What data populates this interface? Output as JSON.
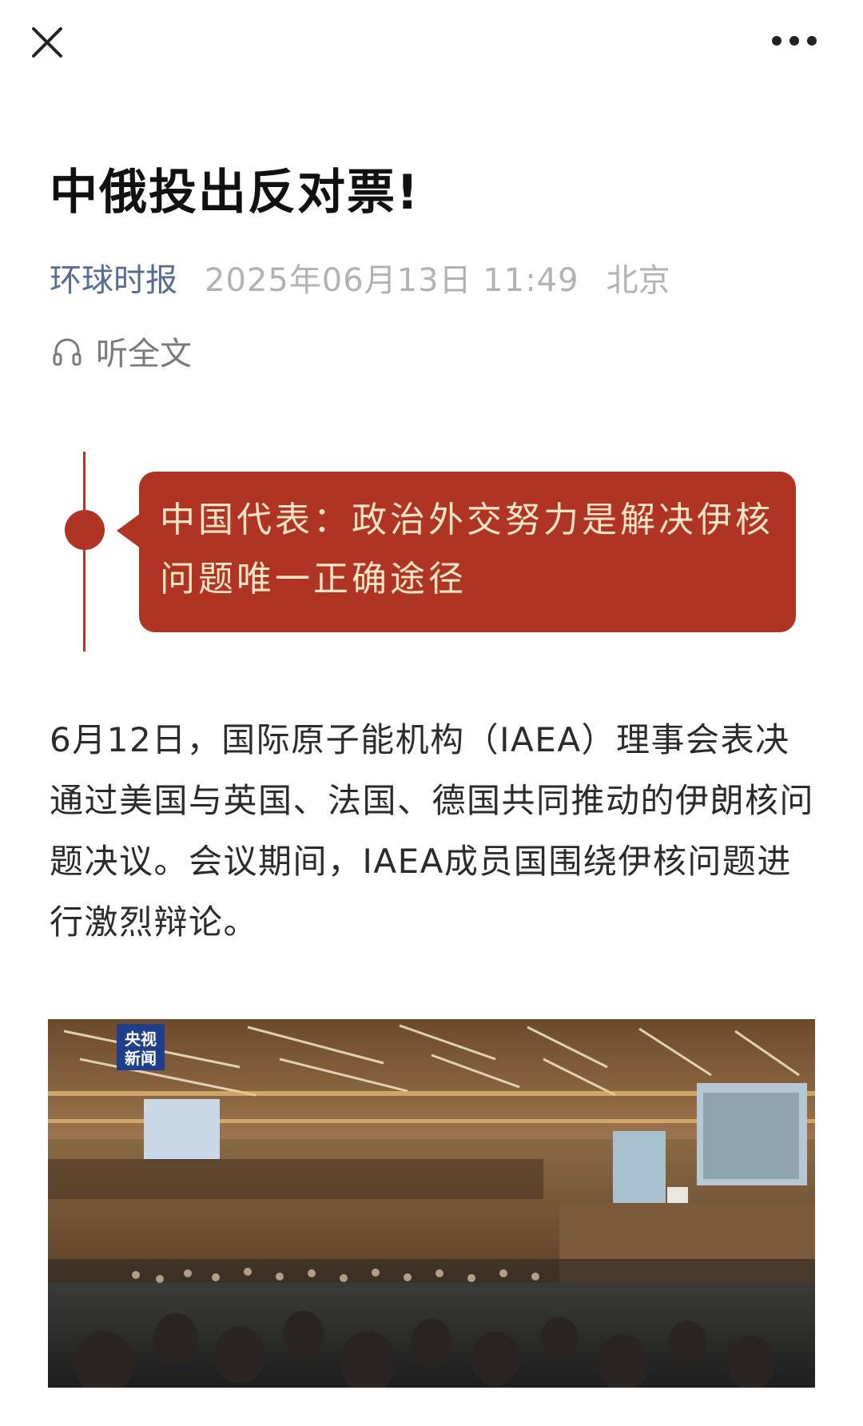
{
  "topbar": {
    "close_icon": "close-icon",
    "more_icon": "more-icon"
  },
  "article": {
    "title": "中俄投出反对票!",
    "source": "环球时报",
    "datetime": "2025年06月13日 11:49",
    "location": "北京",
    "listen_label": "听全文",
    "listen_icon": "headphones-icon",
    "callout": "中国代表：政治外交努力是解决伊核问题唯一正确途径",
    "paragraph": "6月12日，国际原子能机构（IAEA）理事会表决通过美国与英国、法国、德国共同推动的伊朗核问题决议。会议期间，IAEA成员国围绕伊核问题进行激烈辩论。"
  },
  "photo": {
    "watermark_line1": "央视",
    "watermark_line2": "新闻"
  },
  "colors": {
    "accent_red": "#b03424",
    "callout_text": "#f6e4c4",
    "source_link": "#576b95",
    "meta_gray": "#b2b2b2"
  }
}
